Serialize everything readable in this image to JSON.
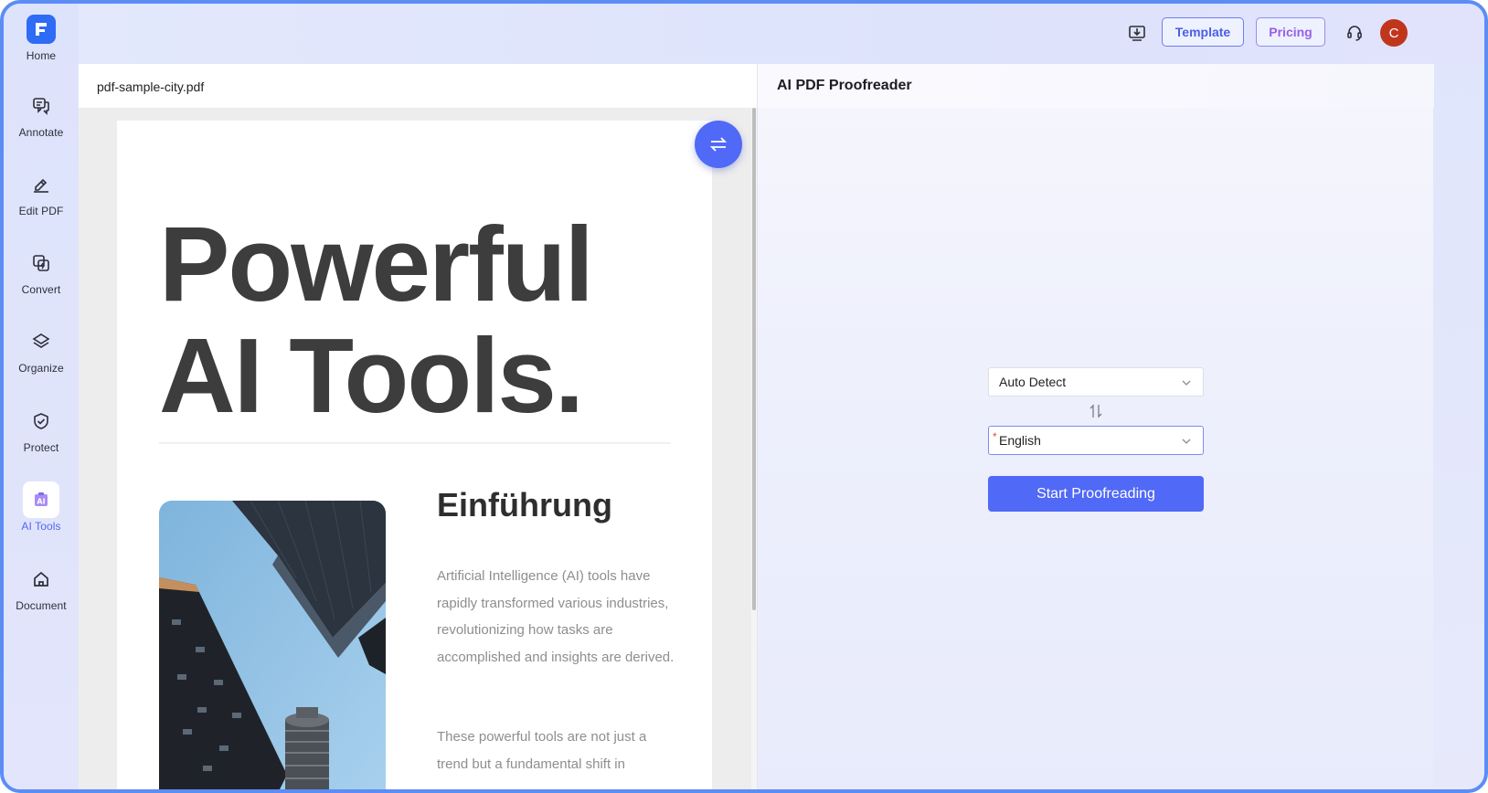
{
  "sidebar": {
    "items": [
      {
        "label": "Home"
      },
      {
        "label": "Annotate"
      },
      {
        "label": "Edit PDF"
      },
      {
        "label": "Convert"
      },
      {
        "label": "Organize"
      },
      {
        "label": "Protect"
      },
      {
        "label": "AI Tools"
      },
      {
        "label": "Document"
      }
    ],
    "active": "AI Tools"
  },
  "topbar": {
    "template_label": "Template",
    "pricing_label": "Pricing",
    "avatar_initial": "C"
  },
  "document": {
    "filename": "pdf-sample-city.pdf",
    "hero_line1": "Powerful",
    "hero_line2": "AI Tools.",
    "section_title": "Einführung",
    "paragraph1": "Artificial Intelligence (AI) tools have rapidly transformed various industries, revolutionizing how tasks are accomplished and insights are derived.",
    "paragraph2": "These powerful tools are not just a trend but a fundamental shift in"
  },
  "proofreader": {
    "title": "AI PDF Proofreader",
    "source_language": "Auto Detect",
    "target_language": "English",
    "start_label": "Start Proofreading"
  },
  "colors": {
    "accent": "#5069f6",
    "frame_border": "#5b8df5",
    "avatar": "#c0361d"
  }
}
